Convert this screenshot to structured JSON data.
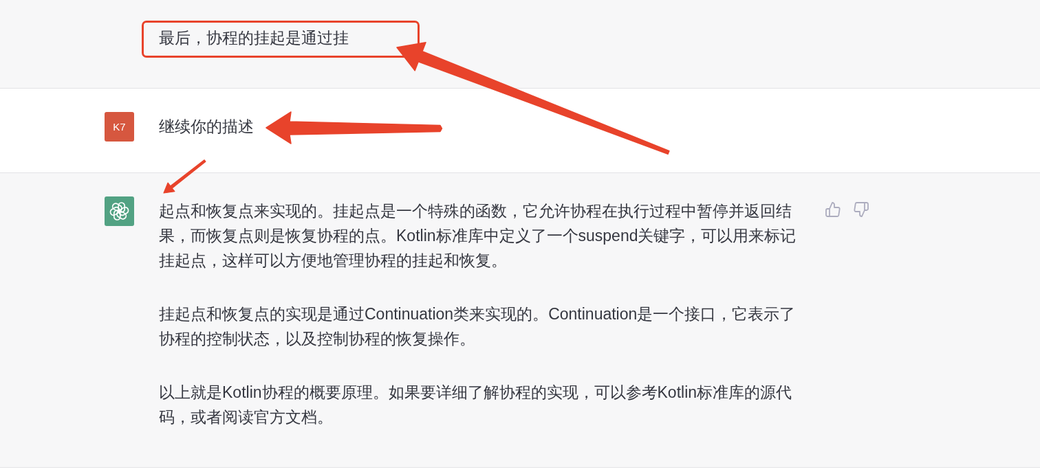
{
  "conversation": [
    {
      "kind": "continuation",
      "highlighted": true,
      "paragraphs": [
        "最后，协程的挂起是通过挂"
      ]
    },
    {
      "kind": "user",
      "avatar_text": "K7",
      "highlighted": false,
      "paragraphs": [
        "继续你的描述"
      ]
    },
    {
      "kind": "assistant",
      "highlighted": false,
      "paragraphs": [
        "起点和恢复点来实现的。挂起点是一个特殊的函数，它允许协程在执行过程中暂停并返回结果，而恢复点则是恢复协程的点。Kotlin标准库中定义了一个suspend关键字，可以用来标记挂起点，这样可以方便地管理协程的挂起和恢复。",
        "挂起点和恢复点的实现是通过Continuation类来实现的。Continuation是一个接口，它表示了协程的控制状态，以及控制协程的恢复操作。",
        "以上就是Kotlin协程的概要原理。如果要详细了解协程的实现，可以参考Kotlin标准库的源代码，或者阅读官方文档。"
      ]
    }
  ]
}
